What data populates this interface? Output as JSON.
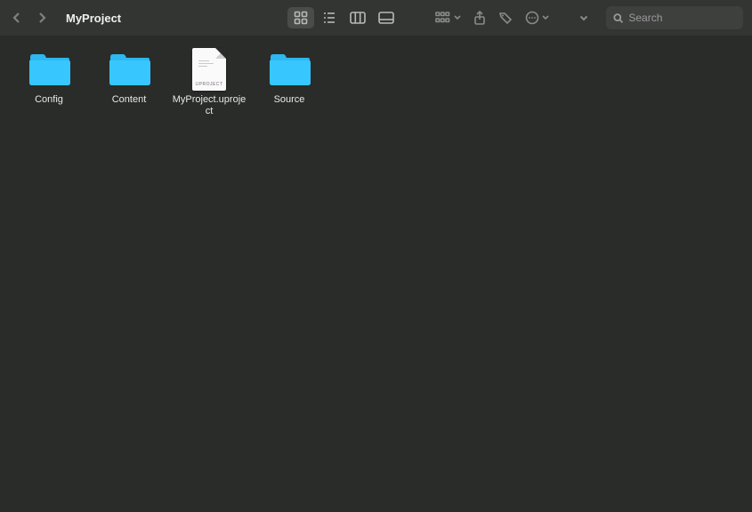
{
  "window": {
    "title": "MyProject"
  },
  "toolbar": {
    "search_placeholder": "Search",
    "search_value": ""
  },
  "items": [
    {
      "name": "Config",
      "kind": "folder"
    },
    {
      "name": "Content",
      "kind": "folder"
    },
    {
      "name": "MyProject.uproject",
      "kind": "file",
      "ext_label": "UPROJECT"
    },
    {
      "name": "Source",
      "kind": "folder"
    }
  ]
}
